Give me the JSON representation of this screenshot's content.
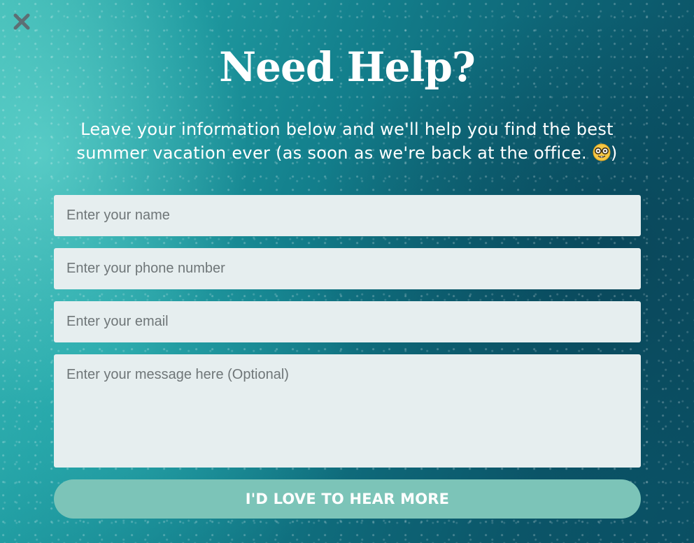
{
  "popup": {
    "close_icon": "close-icon",
    "title": "Need Help?",
    "subtitle_text": "Leave your information below and we'll help you find the best summer vacation ever (as soon as we're back at the office. ",
    "subtitle_end": ")",
    "emoji_icon": "nerd-face-emoji-icon",
    "form": {
      "name_placeholder": "Enter your name",
      "phone_placeholder": "Enter your phone number",
      "email_placeholder": "Enter your email",
      "message_placeholder": "Enter your message here (Optional)",
      "submit_label": "I'D LOVE TO HEAR MORE"
    }
  },
  "colors": {
    "button": "#7cc4b8",
    "field_bg": "#e6eeef",
    "text": "#ffffff"
  }
}
